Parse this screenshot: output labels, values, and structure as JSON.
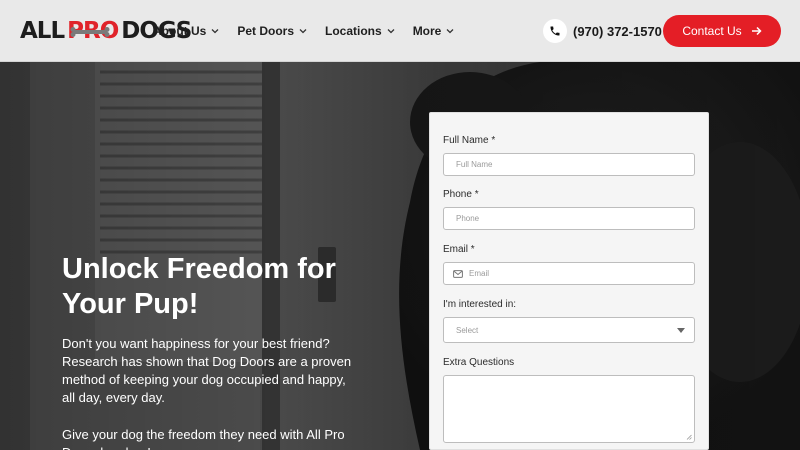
{
  "brand": {
    "logo_left": "ALL",
    "logo_mid": "PRO",
    "logo_right": "DOGS",
    "accent": "#e41e26"
  },
  "nav": {
    "items": [
      {
        "label": "About Us"
      },
      {
        "label": "Pet Doors"
      },
      {
        "label": "Locations"
      },
      {
        "label": "More"
      }
    ]
  },
  "header": {
    "phone": "(970) 372-1570",
    "contact_label": "Contact Us"
  },
  "hero": {
    "title": "Unlock Freedom for Your Pup!",
    "paragraph1": "Don't you want happiness for your best friend? Research has shown that Dog Doors are a proven method of keeping your dog occupied and happy, all day, every day.",
    "paragraph2": "Give your dog the freedom they need with All Pro Dogs dog door!"
  },
  "form": {
    "full_name_label": "Full Name *",
    "full_name_placeholder": "Full Name",
    "phone_label": "Phone *",
    "phone_placeholder": "Phone",
    "email_label": "Email *",
    "email_placeholder": "Email",
    "interest_label": "I'm interested in:",
    "interest_value": "Select",
    "extra_label": "Extra Questions"
  }
}
